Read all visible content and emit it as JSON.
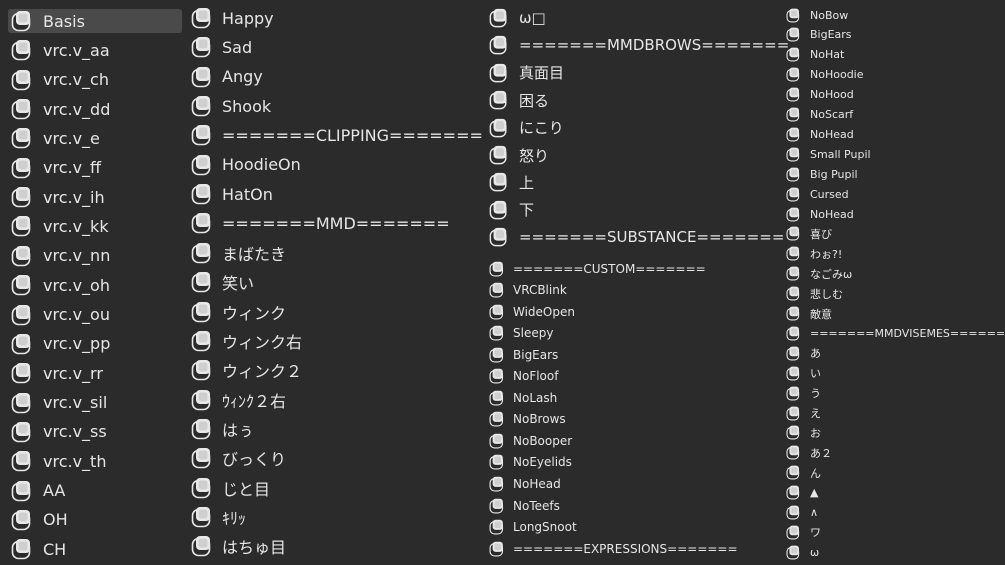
{
  "icon_name": "shape-key-icon",
  "columns": [
    {
      "items": [
        {
          "label": "Basis",
          "selected": true
        },
        {
          "label": "vrc.v_aa"
        },
        {
          "label": "vrc.v_ch"
        },
        {
          "label": "vrc.v_dd"
        },
        {
          "label": "vrc.v_e"
        },
        {
          "label": "vrc.v_ff"
        },
        {
          "label": "vrc.v_ih"
        },
        {
          "label": "vrc.v_kk"
        },
        {
          "label": "vrc.v_nn"
        },
        {
          "label": "vrc.v_oh"
        },
        {
          "label": "vrc.v_ou"
        },
        {
          "label": "vrc.v_pp"
        },
        {
          "label": "vrc.v_rr"
        },
        {
          "label": "vrc.v_sil"
        },
        {
          "label": "vrc.v_ss"
        },
        {
          "label": "vrc.v_th"
        },
        {
          "label": "AA"
        },
        {
          "label": "OH"
        },
        {
          "label": "CH"
        }
      ]
    },
    {
      "items": [
        {
          "label": "Happy"
        },
        {
          "label": "Sad"
        },
        {
          "label": "Angy"
        },
        {
          "label": "Shook"
        },
        {
          "label": "=======CLIPPING======="
        },
        {
          "label": "HoodieOn"
        },
        {
          "label": "HatOn"
        },
        {
          "label": "=======MMD======="
        },
        {
          "label": "まばたき"
        },
        {
          "label": "笑い"
        },
        {
          "label": "ウィンク"
        },
        {
          "label": "ウィンク右"
        },
        {
          "label": "ウィンク２"
        },
        {
          "label": "ｳｨﾝｸ２右"
        },
        {
          "label": "はぅ"
        },
        {
          "label": "びっくり"
        },
        {
          "label": "じと目"
        },
        {
          "label": "ｷﾘｯ"
        },
        {
          "label": "はちゅ目"
        }
      ]
    },
    {
      "items": [
        {
          "label": "ω□",
          "size": "large"
        },
        {
          "label": "=======MMDBROWS=======",
          "size": "large"
        },
        {
          "label": "真面目",
          "size": "large"
        },
        {
          "label": "困る",
          "size": "large"
        },
        {
          "label": "にこり",
          "size": "large"
        },
        {
          "label": "怒り",
          "size": "large"
        },
        {
          "label": "上",
          "size": "large"
        },
        {
          "label": "下",
          "size": "large"
        },
        {
          "label": "=======SUBSTANCE=======",
          "size": "large"
        },
        {
          "label": "=======CUSTOM=======",
          "size": "small"
        },
        {
          "label": "VRCBlink",
          "size": "small"
        },
        {
          "label": "WideOpen",
          "size": "small"
        },
        {
          "label": "Sleepy",
          "size": "small"
        },
        {
          "label": "BigEars",
          "size": "small"
        },
        {
          "label": "NoFloof",
          "size": "small"
        },
        {
          "label": "NoLash",
          "size": "small"
        },
        {
          "label": "NoBrows",
          "size": "small"
        },
        {
          "label": "NoBooper",
          "size": "small"
        },
        {
          "label": "NoEyelids",
          "size": "small"
        },
        {
          "label": "NoHead",
          "size": "small"
        },
        {
          "label": "NoTeefs",
          "size": "small"
        },
        {
          "label": "LongSnoot",
          "size": "small"
        },
        {
          "label": "=======EXPRESSIONS=======",
          "size": "small"
        }
      ]
    },
    {
      "items": [
        {
          "label": "NoBow"
        },
        {
          "label": "BigEars"
        },
        {
          "label": "NoHat"
        },
        {
          "label": "NoHoodie"
        },
        {
          "label": "NoHood"
        },
        {
          "label": "NoScarf"
        },
        {
          "label": "NoHead"
        },
        {
          "label": "Small Pupil"
        },
        {
          "label": "Big Pupil"
        },
        {
          "label": "Cursed"
        },
        {
          "label": "NoHead"
        },
        {
          "label": "喜び"
        },
        {
          "label": "わぉ?!"
        },
        {
          "label": "なごみω"
        },
        {
          "label": "悲しむ"
        },
        {
          "label": "敵意"
        },
        {
          "label": "=======MMDVISEMES======="
        },
        {
          "label": "あ"
        },
        {
          "label": "い"
        },
        {
          "label": "う"
        },
        {
          "label": "え"
        },
        {
          "label": "お"
        },
        {
          "label": "あ２"
        },
        {
          "label": "ん"
        },
        {
          "label": "▲"
        },
        {
          "label": "∧"
        },
        {
          "label": "ワ"
        },
        {
          "label": "ω"
        }
      ]
    }
  ]
}
